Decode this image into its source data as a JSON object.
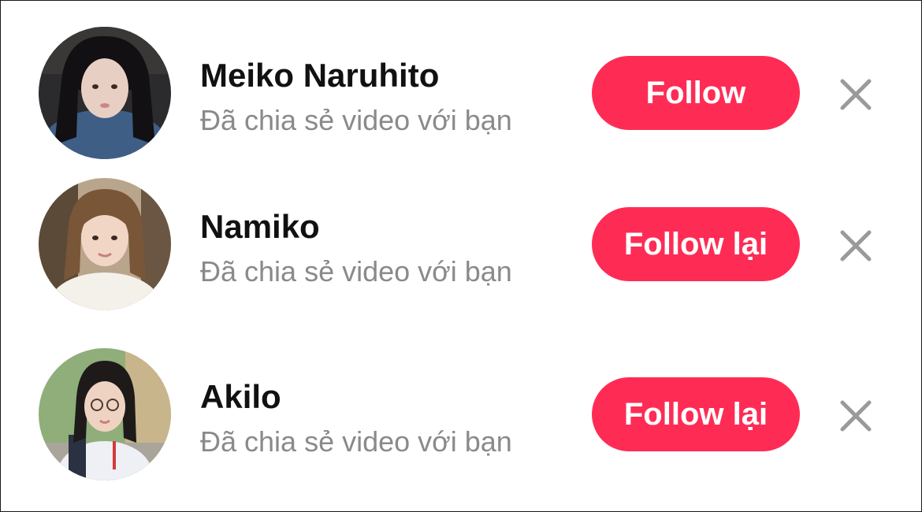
{
  "suggestions": [
    {
      "name": "Meiko Naruhito",
      "subtitle": "Đã chia sẻ video với bạn",
      "button_label": "Follow",
      "avatar": "profile-photo"
    },
    {
      "name": "Namiko",
      "subtitle": "Đã chia sẻ video với bạn",
      "button_label": "Follow lại",
      "avatar": "profile-photo"
    },
    {
      "name": "Akilo",
      "subtitle": "Đã chia sẻ video với bạn",
      "button_label": "Follow lại",
      "avatar": "profile-photo"
    }
  ],
  "colors": {
    "button_bg": "#fe2c55",
    "button_text": "#ffffff",
    "name_text": "#111111",
    "subtitle_text": "#8a8a8a",
    "close_icon": "#9a9a9a"
  },
  "icons": {
    "dismiss": "close-icon"
  }
}
